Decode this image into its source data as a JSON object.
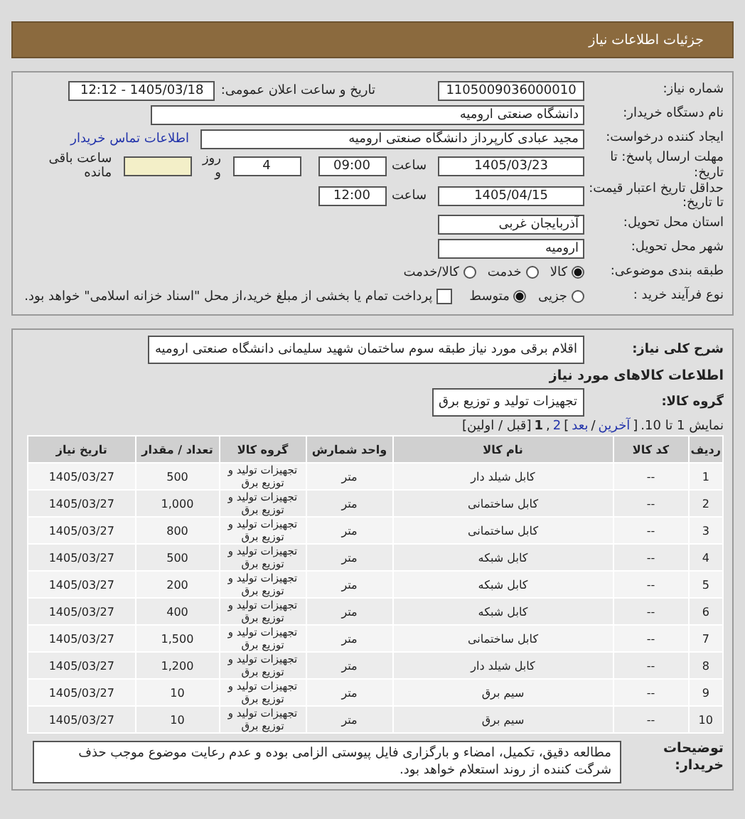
{
  "header": {
    "title": "جزئیات اطلاعات نیاز"
  },
  "need_number": {
    "label": "شماره نیاز:",
    "value": "1105009036000010"
  },
  "announce": {
    "label": "تاریخ و ساعت اعلان عمومی:",
    "value": "1405/03/18 - 12:12"
  },
  "buyer_org": {
    "label": "نام دستگاه خریدار:",
    "value": "دانشگاه صنعتی ارومیه"
  },
  "requester": {
    "label": "ایجاد کننده درخواست:",
    "value": "مجید عبادی کارپرداز دانشگاه صنعتی ارومیه",
    "link": "اطلاعات تماس خریدار"
  },
  "deadline": {
    "label": "مهلت ارسال پاسخ: تا تاریخ:",
    "date": "1405/03/23",
    "time_label": "ساعت",
    "time": "09:00",
    "days": "4",
    "days_label": "روز و",
    "remaining_label": "ساعت باقی مانده"
  },
  "validity": {
    "label": "حداقل تاریخ اعتبار قیمت: تا تاریخ:",
    "date": "1405/04/15",
    "time_label": "ساعت",
    "time": "12:00"
  },
  "province": {
    "label": "استان محل تحویل:",
    "value": "آذربایجان غربی"
  },
  "city": {
    "label": "شهر محل تحویل:",
    "value": "ارومیه"
  },
  "category": {
    "label": "طبقه بندی موضوعی:",
    "options": [
      {
        "label": "کالا",
        "selected": true
      },
      {
        "label": "خدمت",
        "selected": false
      },
      {
        "label": "کالا/خدمت",
        "selected": false
      }
    ]
  },
  "process": {
    "label": "نوع فرآیند خرید :",
    "options": [
      {
        "label": "جزیی",
        "selected": false
      },
      {
        "label": "متوسط",
        "selected": true
      }
    ],
    "payment": {
      "checked": false,
      "text": "پرداخت تمام یا بخشی از مبلغ خرید،از محل \"اسناد خزانه اسلامی\" خواهد بود."
    }
  },
  "description": {
    "label": "شرح کلی نیاز:",
    "value": "اقلام برقی مورد نیاز طبقه سوم ساختمان شهید سلیمانی دانشگاه صنعتی ارومیه"
  },
  "goods_heading": "اطلاعات کالاهای مورد نیاز",
  "goods_group": {
    "label": "گروه کالا:",
    "value": "تجهیزات تولید و توزیع برق"
  },
  "pagination": [
    {
      "kind": "text",
      "text": "نمایش 1 تا 10."
    },
    {
      "kind": "text",
      "text": "["
    },
    {
      "kind": "link",
      "text": "آخرین"
    },
    {
      "kind": "text",
      "text": "/"
    },
    {
      "kind": "link",
      "text": "بعد"
    },
    {
      "kind": "text",
      "text": "]"
    },
    {
      "kind": "link",
      "text": "2"
    },
    {
      "kind": "text",
      "text": ","
    },
    {
      "kind": "current",
      "text": "1"
    },
    {
      "kind": "text",
      "text": "[قبل / اولین]"
    }
  ],
  "table": {
    "columns": [
      "ردیف",
      "کد کالا",
      "نام کالا",
      "واحد شمارش",
      "گروه کالا",
      "تعداد / مقدار",
      "تاریخ نیاز"
    ],
    "rows": [
      [
        "1",
        "--",
        "کابل شیلد دار",
        "متر",
        "تجهیزات تولید و توزیع برق",
        "500",
        "1405/03/27"
      ],
      [
        "2",
        "--",
        "کابل ساختمانی",
        "متر",
        "تجهیزات تولید و توزیع برق",
        "1,000",
        "1405/03/27"
      ],
      [
        "3",
        "--",
        "کابل ساختمانی",
        "متر",
        "تجهیزات تولید و توزیع برق",
        "800",
        "1405/03/27"
      ],
      [
        "4",
        "--",
        "کابل شبکه",
        "متر",
        "تجهیزات تولید و توزیع برق",
        "500",
        "1405/03/27"
      ],
      [
        "5",
        "--",
        "کابل شبکه",
        "متر",
        "تجهیزات تولید و توزیع برق",
        "200",
        "1405/03/27"
      ],
      [
        "6",
        "--",
        "کابل شبکه",
        "متر",
        "تجهیزات تولید و توزیع برق",
        "400",
        "1405/03/27"
      ],
      [
        "7",
        "--",
        "کابل ساختمانی",
        "متر",
        "تجهیزات تولید و توزیع برق",
        "1,500",
        "1405/03/27"
      ],
      [
        "8",
        "--",
        "کابل شیلد دار",
        "متر",
        "تجهیزات تولید و توزیع برق",
        "1,200",
        "1405/03/27"
      ],
      [
        "9",
        "--",
        "سیم برق",
        "متر",
        "تجهیزات تولید و توزیع برق",
        "10",
        "1405/03/27"
      ],
      [
        "10",
        "--",
        "سیم برق",
        "متر",
        "تجهیزات تولید و توزیع برق",
        "10",
        "1405/03/27"
      ]
    ]
  },
  "remarks": {
    "label": "توضیحات خریدار:",
    "text": "مطالعه دقیق، تکمیل، امضاء و بارگزاری فایل پیوستی الزامی بوده و عدم رعایت موضوع موجب حذف شرگت کننده از روند استعلام خواهد بود."
  }
}
